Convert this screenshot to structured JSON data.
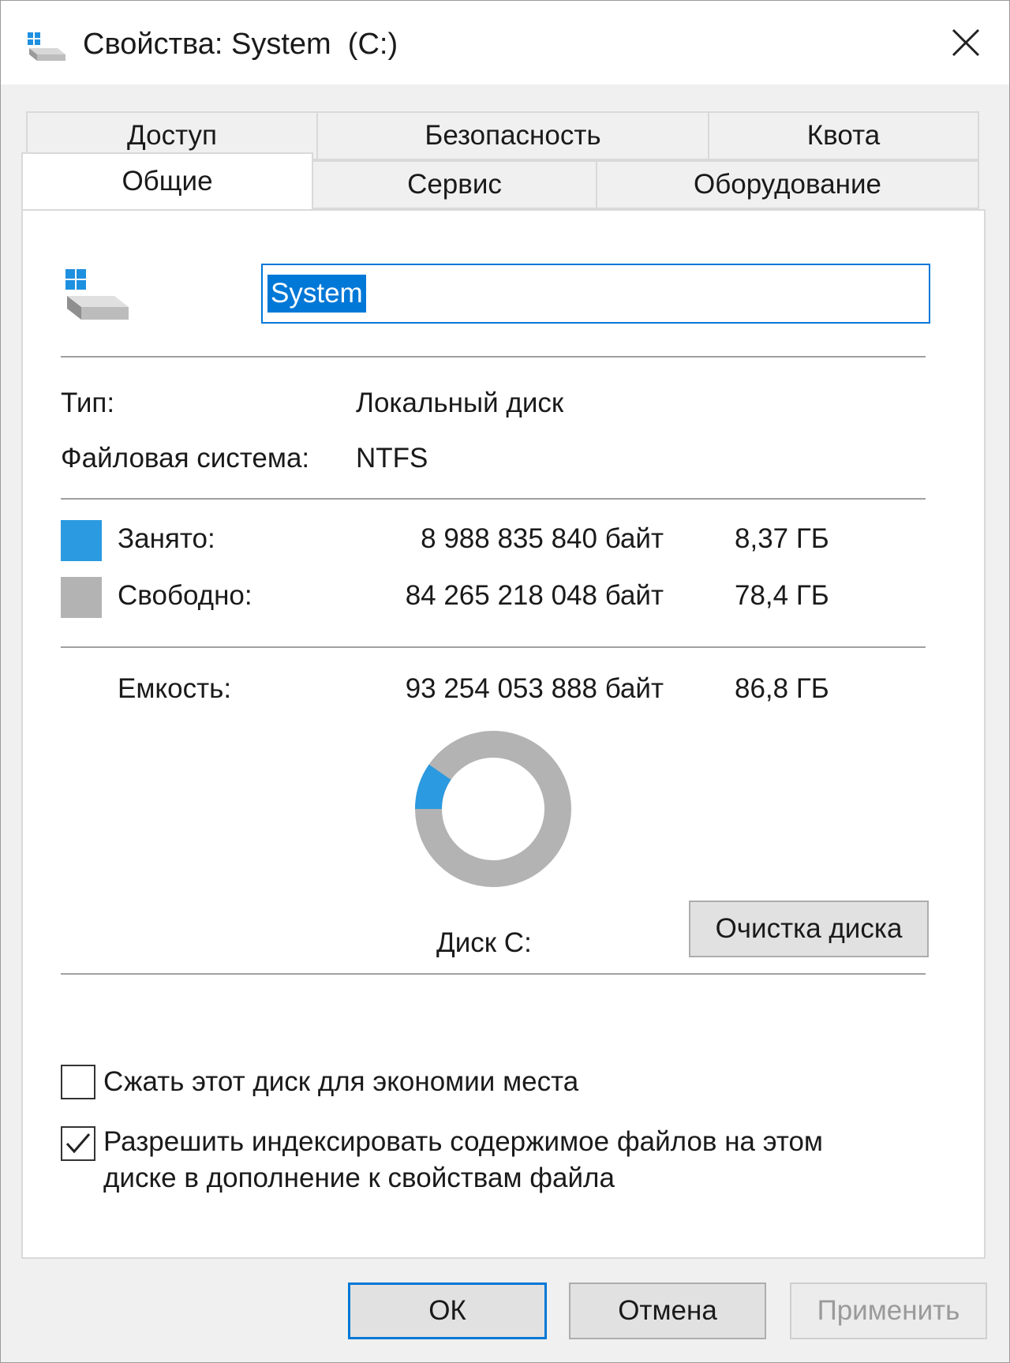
{
  "window": {
    "title": "Свойства: System  (C:)"
  },
  "tabs": {
    "row1": [
      "Доступ",
      "Безопасность",
      "Квота"
    ],
    "row2": [
      "Общие",
      "Сервис",
      "Оборудование"
    ],
    "active": "Общие"
  },
  "general": {
    "volume_name": "System",
    "type_label": "Тип:",
    "type_value": "Локальный диск",
    "fs_label": "Файловая система:",
    "fs_value": "NTFS",
    "used_label": "Занято:",
    "used_bytes": "8 988 835 840 байт",
    "used_gb": "8,37 ГБ",
    "free_label": "Свободно:",
    "free_bytes": "84 265 218 048 байт",
    "free_gb": "78,4 ГБ",
    "capacity_label": "Емкость:",
    "capacity_bytes": "93 254 053 888 байт",
    "capacity_gb": "86,8 ГБ",
    "disk_label": "Диск C:",
    "cleanup_button": "Очистка диска",
    "compress_label": "Сжать этот диск для экономии места",
    "compress_checked": false,
    "index_label_line1": "Разрешить индексировать содержимое файлов на этом",
    "index_label_line2": "диске в дополнение к свойствам файла",
    "index_checked": true,
    "used_fraction": 0.0964
  },
  "colors": {
    "used": "#2b9ae0",
    "free": "#b3b3b3",
    "accent": "#0078d7"
  },
  "buttons": {
    "ok": "ОК",
    "cancel": "Отмена",
    "apply": "Применить"
  }
}
